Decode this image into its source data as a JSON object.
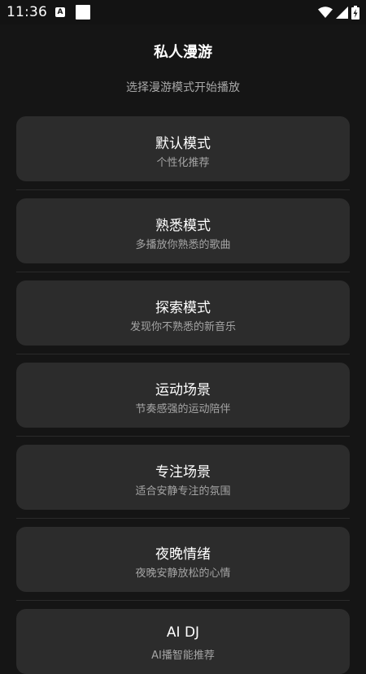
{
  "status_bar": {
    "time": "11:36",
    "a_label": "A",
    "icons": [
      "a-notification-icon",
      "square-notification-icon",
      "wifi-icon",
      "signal-icon",
      "battery-charging-icon"
    ]
  },
  "header": {
    "title": "私人漫游",
    "subtitle": "选择漫游模式开始播放"
  },
  "modes": [
    {
      "title": "默认模式",
      "desc": "个性化推荐"
    },
    {
      "title": "熟悉模式",
      "desc": "多播放你熟悉的歌曲"
    },
    {
      "title": "探索模式",
      "desc": "发现你不熟悉的新音乐"
    },
    {
      "title": "运动场景",
      "desc": "节奏感强的运动陪伴"
    },
    {
      "title": "专注场景",
      "desc": "适合安静专注的氛围"
    },
    {
      "title": "夜晚情绪",
      "desc": "夜晚安静放松的心情"
    },
    {
      "title": "AI DJ",
      "desc": "AI播智能推荐"
    }
  ],
  "colors": {
    "background": "#151515",
    "card": "#2c2c2c",
    "text_primary": "#ffffff",
    "text_secondary": "#a5a5a5"
  }
}
